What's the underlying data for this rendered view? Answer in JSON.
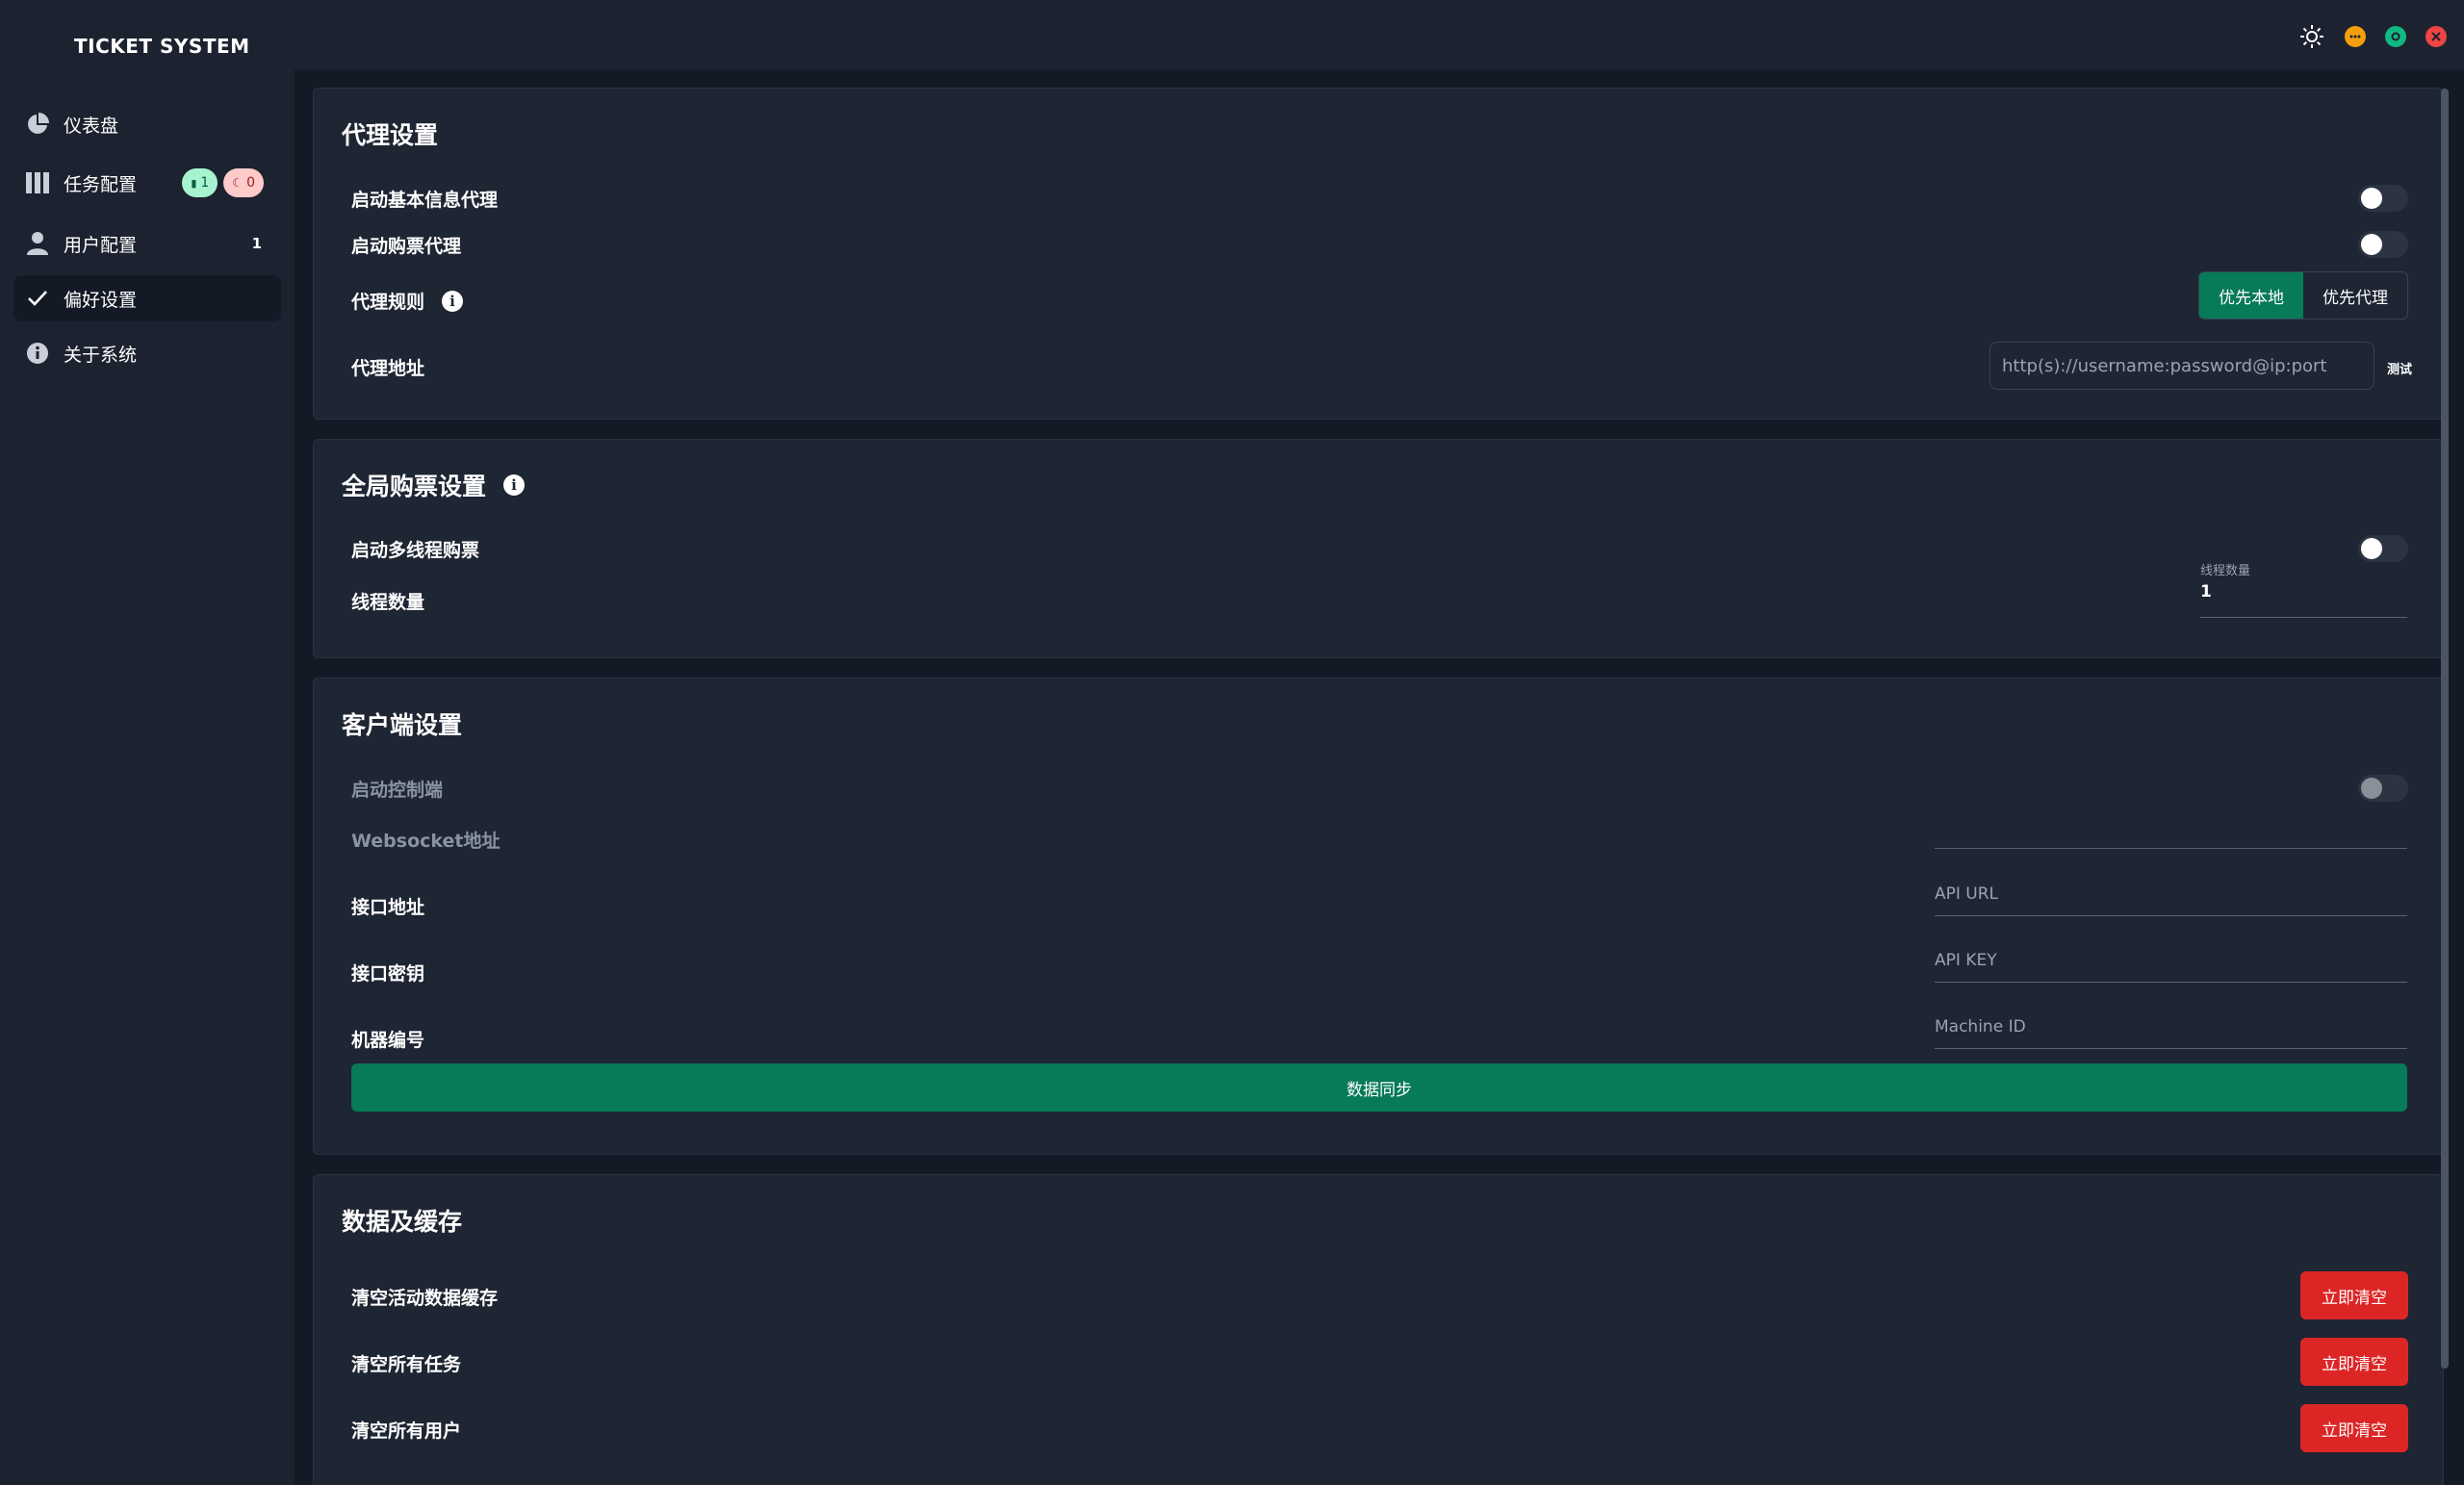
{
  "app": {
    "title": "TICKET SYSTEM"
  },
  "sidebar": {
    "items": [
      {
        "label": "仪表盘",
        "icon": "pie-chart-icon"
      },
      {
        "label": "任务配置",
        "icon": "columns-icon",
        "badges": [
          "1",
          "0"
        ]
      },
      {
        "label": "用户配置",
        "icon": "user-icon",
        "count": "1"
      },
      {
        "label": "偏好设置",
        "icon": "check-icon",
        "active": true
      },
      {
        "label": "关于系统",
        "icon": "info-icon"
      }
    ]
  },
  "window_controls": [
    "sun-icon",
    "minimize-icon",
    "maximize-icon",
    "close-icon"
  ],
  "proxy": {
    "title": "代理设置",
    "basic_proxy_label": "启动基本信息代理",
    "basic_proxy_on": false,
    "purchase_proxy_label": "启动购票代理",
    "purchase_proxy_on": false,
    "rule_label": "代理规则",
    "rule_options": [
      "优先本地",
      "优先代理"
    ],
    "rule_selected": "优先本地",
    "address_label": "代理地址",
    "address_placeholder": "http(s)://username:password@ip:port",
    "test_label": "测试"
  },
  "global": {
    "title": "全局购票设置",
    "multithread_label": "启动多线程购票",
    "multithread_on": false,
    "thread_count_label": "线程数量",
    "thread_field_label": "线程数量",
    "thread_count_value": "1"
  },
  "client": {
    "title": "客户端设置",
    "control_label": "启动控制端",
    "control_on": false,
    "websocket_label": "Websocket地址",
    "api_url_label": "接口地址",
    "api_url_placeholder": "API URL",
    "api_key_label": "接口密钥",
    "api_key_placeholder": "API KEY",
    "machine_label": "机器编号",
    "machine_placeholder": "Machine ID",
    "sync_label": "数据同步"
  },
  "cache": {
    "title": "数据及缓存",
    "rows": [
      {
        "label": "清空活动数据缓存",
        "button": "立即清空"
      },
      {
        "label": "清空所有任务",
        "button": "立即清空"
      },
      {
        "label": "清空所有用户",
        "button": "立即清空"
      }
    ]
  },
  "colors": {
    "background": "#1d2230",
    "main_bg": "#141a25",
    "card_bg": "#1e2533",
    "accent_green": "#077a57",
    "danger_red": "#dc2626"
  }
}
